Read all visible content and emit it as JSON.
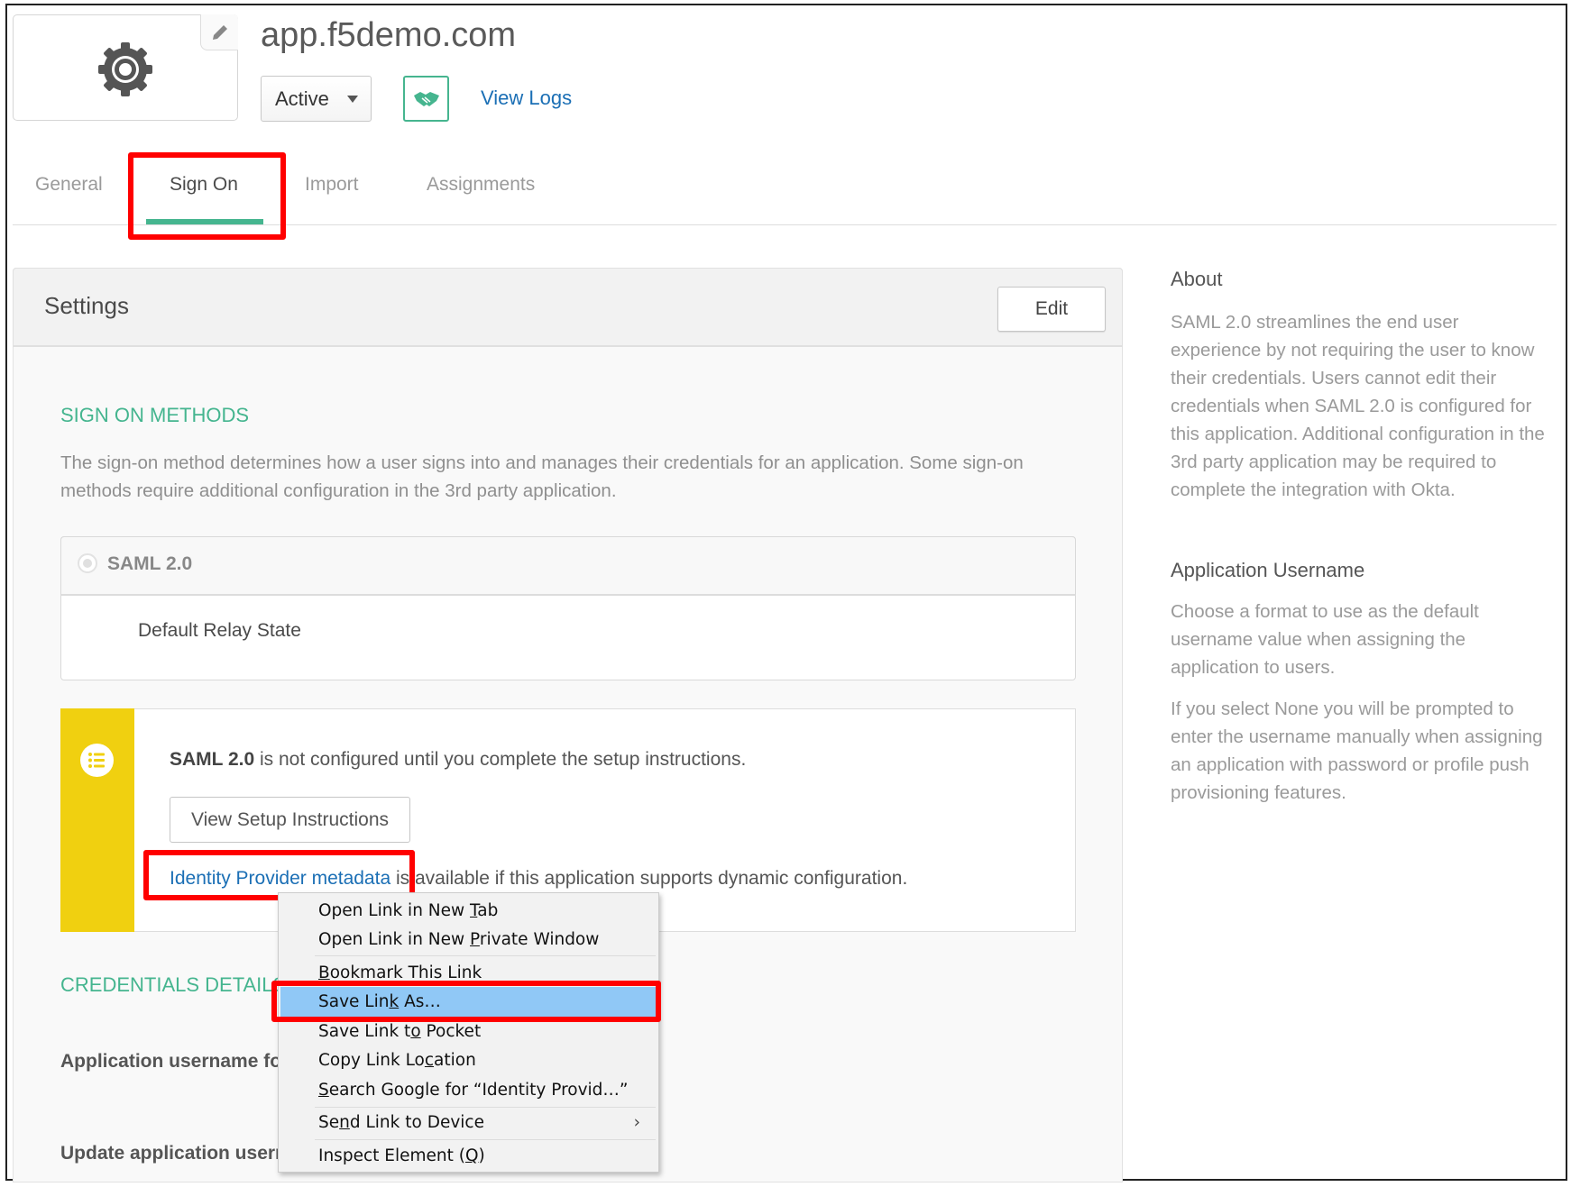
{
  "app": {
    "title": "app.f5demo.com",
    "status": "Active",
    "view_logs": "View Logs"
  },
  "tabs": [
    {
      "label": "General"
    },
    {
      "label": "Sign On"
    },
    {
      "label": "Import"
    },
    {
      "label": "Assignments"
    }
  ],
  "settings": {
    "title": "Settings",
    "edit": "Edit",
    "sign_on_methods": {
      "heading": "SIGN ON METHODS",
      "description": "The sign-on method determines how a user signs into and manages their credentials for an application. Some sign-on methods require additional configuration in the 3rd party application.",
      "method": "SAML 2.0",
      "relay_state_label": "Default Relay State"
    },
    "callout": {
      "bold": "SAML 2.0",
      "text": " is not configured until you complete the setup instructions.",
      "button": "View Setup Instructions",
      "link": "Identity Provider metadata",
      "link_suffix": " is available if this application supports dynamic configuration."
    },
    "credentials": {
      "heading": "CREDENTIALS DETAILS",
      "app_username_label": "Application username format",
      "update_label": "Update application username on"
    }
  },
  "about": {
    "heading": "About",
    "text": "SAML 2.0 streamlines the end user experience by not requiring the user to know their credentials. Users cannot edit their credentials when SAML 2.0 is configured for this application. Additional configuration in the 3rd party application may be required to complete the integration with Okta.",
    "username_heading": "Application Username",
    "username_text": "Choose a format to use as the default username value when assigning the application to users.",
    "none_text": "If you select None you will be prompted to enter the username manually when assigning an application with password or profile push provisioning features."
  },
  "context_menu": {
    "items": [
      {
        "pre": "Open Link in New ",
        "key": "T",
        "post": "ab"
      },
      {
        "pre": "Open Link in New ",
        "key": "P",
        "post": "rivate Window"
      },
      {
        "pre": "",
        "key": "B",
        "post": "ookmark This Link"
      },
      {
        "pre": "Save Lin",
        "key": "k",
        "post": " As…"
      },
      {
        "pre": "Save Link t",
        "key": "o",
        "post": " Pocket"
      },
      {
        "pre": "Copy Link Lo",
        "key": "c",
        "post": "ation"
      },
      {
        "pre": "",
        "key": "S",
        "post": "earch Google for “Identity Provid…”"
      },
      {
        "pre": "Se",
        "key": "n",
        "post": "d Link to Device"
      },
      {
        "pre": "Inspect Element (",
        "key": "Q",
        "post": ")"
      }
    ],
    "highlighted": "Save Link As…"
  },
  "colors": {
    "accent": "#45b58f",
    "link": "#1b6fb5",
    "callout": "#f0d010",
    "highlight": "#90c8f6",
    "annotation": "#ff0000"
  }
}
